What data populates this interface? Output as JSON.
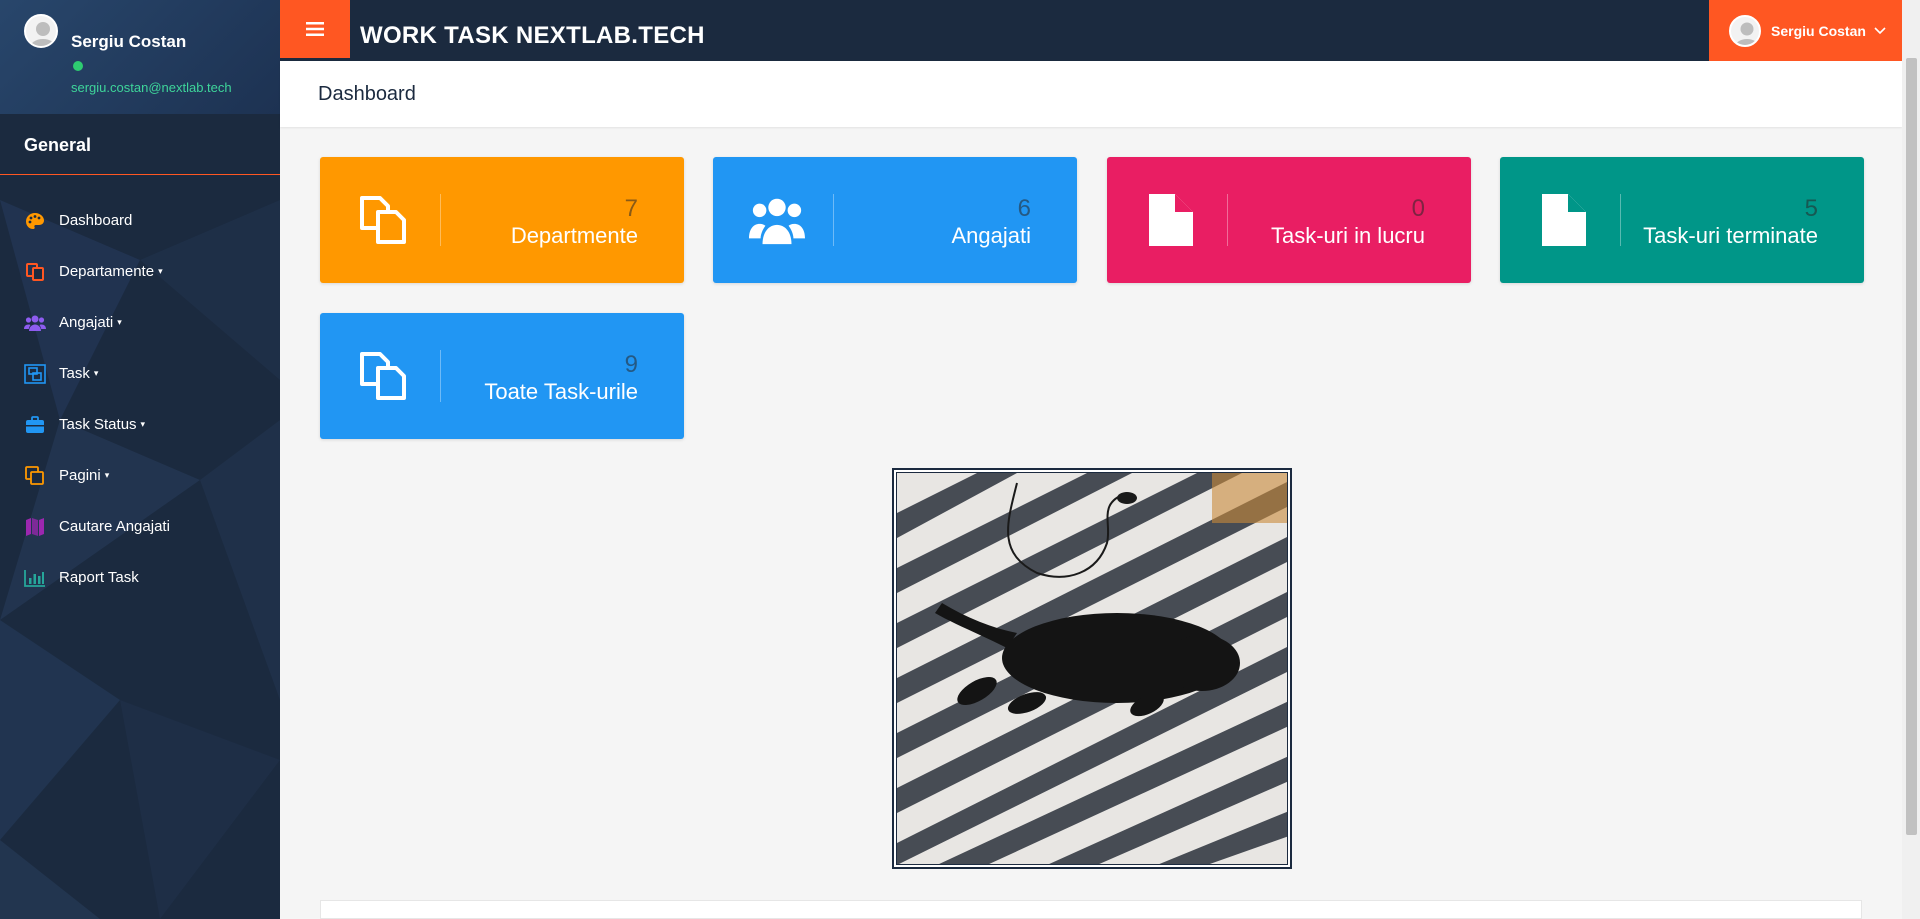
{
  "sidebar": {
    "user_name": "Sergiu Costan",
    "user_email": "sergiu.costan@nextlab.tech",
    "section_title": "General",
    "items": [
      {
        "label": "Dashboard",
        "icon": "palette-icon",
        "color": "#ff9800",
        "caret": ""
      },
      {
        "label": "Departamente",
        "icon": "copy-icon",
        "color": "#ff5722",
        "caret": "▾"
      },
      {
        "label": "Angajati",
        "icon": "users-icon",
        "color": "#8e5cf0",
        "caret": "▾"
      },
      {
        "label": "Task",
        "icon": "object-group-icon",
        "color": "#2196f3",
        "caret": "▾"
      },
      {
        "label": "Task Status",
        "icon": "briefcase-icon",
        "color": "#2196f3",
        "caret": "▾"
      },
      {
        "label": "Pagini",
        "icon": "clone-icon",
        "color": "#ff9800",
        "caret": "▾"
      },
      {
        "label": "Cautare Angajati",
        "icon": "map-icon",
        "color": "#9c27b0",
        "caret": ""
      },
      {
        "label": "Raport Task",
        "icon": "chart-bar-icon",
        "color": "#26a69a",
        "caret": ""
      }
    ]
  },
  "topbar": {
    "brand": "WORK TASK NEXTLAB.TECH",
    "user_name": "Sergiu Costan"
  },
  "page": {
    "title": "Dashboard"
  },
  "cards": [
    {
      "value": "7",
      "label": "Departmente",
      "icon": "copy-icon",
      "color": "#ff9800"
    },
    {
      "value": "6",
      "label": "Angajati",
      "icon": "users-icon",
      "color": "#2196f3"
    },
    {
      "value": "0",
      "label": "Task-uri in lucru",
      "icon": "file-icon",
      "color": "#e91e63"
    },
    {
      "value": "5",
      "label": "Task-uri terminate",
      "icon": "file-icon",
      "color": "#009688"
    },
    {
      "value": "9",
      "label": "Toate Task-urile",
      "icon": "copy-icon",
      "color": "#2196f3"
    }
  ],
  "colors": {
    "accent": "#ff5722",
    "navy": "#1b2a3f",
    "online": "#2ecc71"
  }
}
